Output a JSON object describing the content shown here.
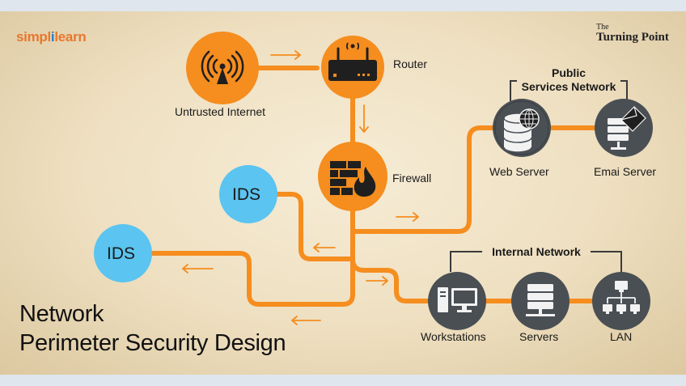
{
  "branding": {
    "simplilearn_a": "simpl",
    "simplilearn_b": "i",
    "simplilearn_c": "learn",
    "tp_small": "The",
    "tp_big": "Turning Point"
  },
  "nodes": {
    "internet": "Untrusted Internet",
    "router": "Router",
    "firewall": "Firewall",
    "ids_top": "IDS",
    "ids_left": "IDS",
    "web_server": "Web Server",
    "email_server": "Emai Server",
    "workstations": "Workstations",
    "servers": "Servers",
    "lan": "LAN"
  },
  "groups": {
    "public_line1": "Public",
    "public_line2": "Services Network",
    "internal": "Internal Network"
  },
  "title": {
    "line1": "Network",
    "line2": "Perimeter Security Design"
  },
  "colors": {
    "orange": "#f58d1f",
    "blue": "#5bc4f0",
    "gray": "#4a4f54",
    "icon_dark": "#1f1f1f"
  }
}
